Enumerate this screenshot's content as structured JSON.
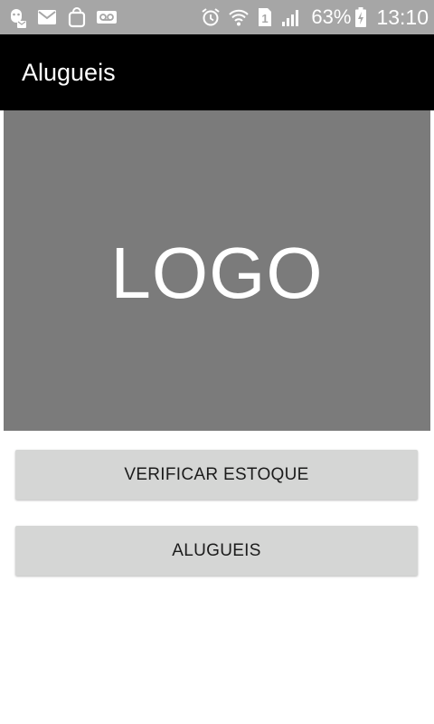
{
  "status_bar": {
    "battery_percent": "63%",
    "time": "13:10",
    "sim_slot": "1",
    "icons": {
      "left": [
        "notification-app-icon",
        "mail-icon",
        "shopping-bag-icon",
        "voicemail-icon"
      ],
      "right": [
        "alarm-icon",
        "wifi-icon",
        "sim-icon",
        "signal-icon",
        "battery-charging-icon"
      ]
    }
  },
  "app_bar": {
    "title": "Alugueis"
  },
  "logo": {
    "text": "LOGO"
  },
  "buttons": {
    "check_stock": "VERIFICAR ESTOQUE",
    "rentals": "ALUGUEIS"
  },
  "colors": {
    "status_bar_bg": "#a6a6a6",
    "app_bar_bg": "#000000",
    "logo_bg": "#7b7b7b",
    "button_bg": "#d5d6d5",
    "button_text": "#1c1c1c"
  }
}
